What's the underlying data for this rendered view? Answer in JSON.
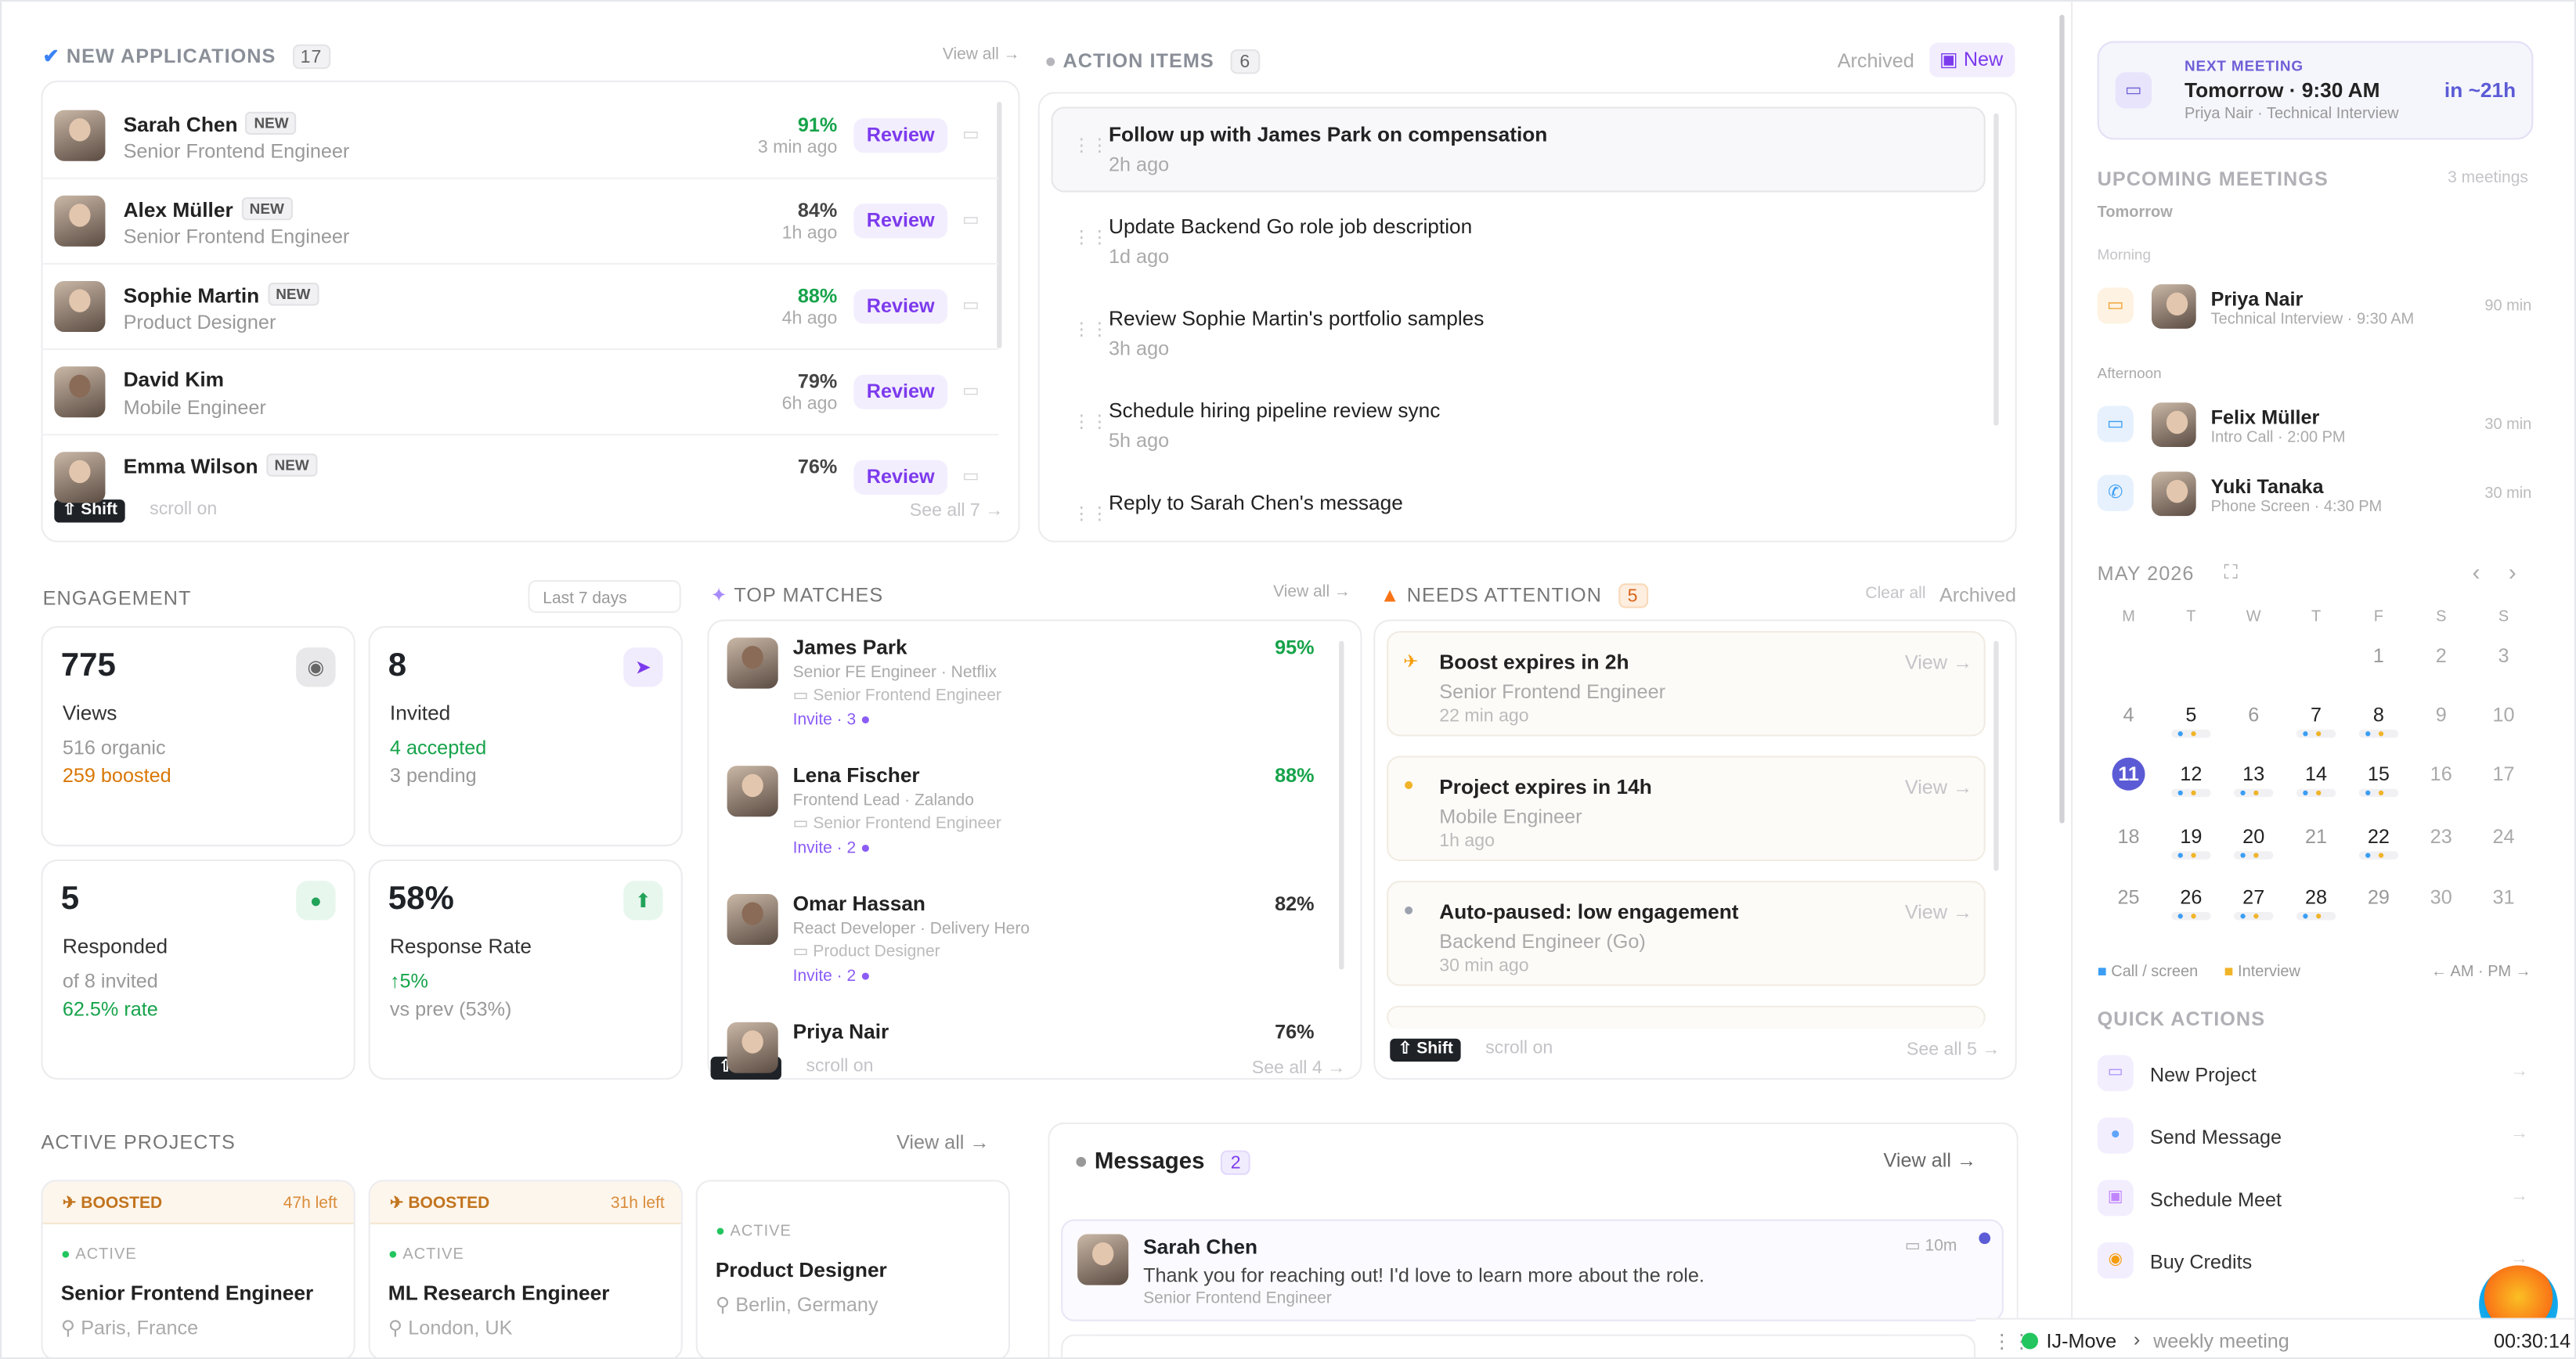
{
  "applications": {
    "title": "NEW APPLICATIONS",
    "count": "17",
    "view_all": "View all →",
    "items": [
      {
        "name": "Sarah Chen",
        "badge": "NEW",
        "role": "Senior Frontend Engineer",
        "score": "91%",
        "time": "3 min ago",
        "action": "Review"
      },
      {
        "name": "Alex Müller",
        "badge": "NEW",
        "role": "Senior Frontend Engineer",
        "score": "84%",
        "time": "1h ago",
        "action": "Review"
      },
      {
        "name": "Sophie Martin",
        "badge": "NEW",
        "role": "Product Designer",
        "score": "88%",
        "time": "4h ago",
        "action": "Review"
      },
      {
        "name": "David Kim",
        "badge": "",
        "role": "Mobile Engineer",
        "score": "79%",
        "time": "6h ago",
        "action": "Review"
      },
      {
        "name": "Emma Wilson",
        "badge": "NEW",
        "role": "",
        "score": "76%",
        "time": "",
        "action": "Review"
      }
    ],
    "shift": "⇧ Shift",
    "scroll_hint": "scroll on",
    "see_all": "See all 7 →"
  },
  "actions": {
    "title": "ACTION ITEMS",
    "count": "6",
    "archived": "Archived",
    "new_label": "New",
    "items": [
      {
        "text": "Follow up with James Park on compensation",
        "time": "2h ago"
      },
      {
        "text": "Update Backend Go role job description",
        "time": "1d ago"
      },
      {
        "text": "Review Sophie Martin's portfolio samples",
        "time": "3h ago"
      },
      {
        "text": "Schedule hiring pipeline review sync",
        "time": "5h ago"
      },
      {
        "text": "Reply to Sarah Chen's message",
        "time": ""
      }
    ]
  },
  "engagement": {
    "title": "ENGAGEMENT",
    "range": "Last 7 days",
    "views": {
      "num": "775",
      "label": "Views",
      "l1": "516 organic",
      "l2": "259 boosted"
    },
    "invited": {
      "num": "8",
      "label": "Invited",
      "l1": "4 accepted",
      "l2": "3 pending"
    },
    "responded": {
      "num": "5",
      "label": "Responded",
      "l1": "of 8 invited",
      "l2": "62.5% rate"
    },
    "rate": {
      "num": "58%",
      "label": "Response Rate",
      "l1": "↑5%",
      "l2": "vs prev (53%)"
    }
  },
  "matches": {
    "title": "TOP MATCHES",
    "view_all": "View all →",
    "items": [
      {
        "name": "James Park",
        "sub": "Senior FE Engineer · Netflix",
        "role": "Senior Frontend Engineer",
        "invite": "Invite · 3",
        "score": "95%"
      },
      {
        "name": "Lena Fischer",
        "sub": "Frontend Lead · Zalando",
        "role": "Senior Frontend Engineer",
        "invite": "Invite · 2",
        "score": "88%"
      },
      {
        "name": "Omar Hassan",
        "sub": "React Developer · Delivery Hero",
        "role": "Product Designer",
        "invite": "Invite · 2",
        "score": "82%"
      },
      {
        "name": "Priya Nair",
        "sub": "",
        "role": "",
        "invite": "",
        "score": "76%"
      }
    ],
    "shift": "⇧ Shift",
    "scroll_hint": "scroll on",
    "see_all": "See all 4 →"
  },
  "attention": {
    "title": "NEEDS ATTENTION",
    "count": "5",
    "clear_all": "Clear all",
    "archived": "Archived",
    "items": [
      {
        "title": "Boost expires in 2h",
        "sub": "Senior Frontend Engineer",
        "time": "22 min ago",
        "view": "View →"
      },
      {
        "title": "Project expires in 14h",
        "sub": "Mobile Engineer",
        "time": "1h ago",
        "view": "View →"
      },
      {
        "title": "Auto-paused: low engagement",
        "sub": "Backend Engineer (Go)",
        "time": "30 min ago",
        "view": "View →"
      }
    ],
    "shift": "⇧ Shift",
    "scroll_hint": "scroll on",
    "see_all": "See all 5 →"
  },
  "projects": {
    "title": "ACTIVE PROJECTS",
    "view_all": "View all →",
    "items": [
      {
        "boost": "BOOSTED",
        "left": "47h left",
        "status": "ACTIVE",
        "name": "Senior Frontend Engineer",
        "location": "Paris, France"
      },
      {
        "boost": "BOOSTED",
        "left": "31h left",
        "status": "ACTIVE",
        "name": "ML Research Engineer",
        "location": "London, UK"
      },
      {
        "boost": "",
        "left": "",
        "status": "ACTIVE",
        "name": "Product Designer",
        "location": "Berlin, Germany"
      }
    ]
  },
  "messages": {
    "title": "Messages",
    "count": "2",
    "view_all": "View all →",
    "items": [
      {
        "name": "Sarah Chen",
        "text": "Thank you for reaching out! I'd love to learn more about the role.",
        "role": "Senior Frontend Engineer",
        "time": "10m"
      }
    ]
  },
  "next_meeting": {
    "label": "NEXT MEETING",
    "when": "Tomorrow · 9:30 AM",
    "who": "Priya Nair · Technical Interview",
    "in": "in ~21h"
  },
  "upcoming": {
    "title": "UPCOMING MEETINGS",
    "count": "3 meetings",
    "day": "Tomorrow",
    "morning": "Morning",
    "afternoon": "Afternoon",
    "items": [
      {
        "name": "Priya Nair",
        "sub": "Technical Interview · 9:30 AM",
        "dur": "90 min"
      },
      {
        "name": "Felix Müller",
        "sub": "Intro Call · 2:00 PM",
        "dur": "30 min"
      },
      {
        "name": "Yuki Tanaka",
        "sub": "Phone Screen · 4:30 PM",
        "dur": "30 min"
      }
    ]
  },
  "calendar": {
    "month": "MAY 2026",
    "weekdays": [
      "M",
      "T",
      "W",
      "T",
      "F",
      "S",
      "S"
    ],
    "rows": [
      [
        "",
        "",
        "",
        "",
        "1",
        "2",
        "3"
      ],
      [
        "4",
        "5",
        "6",
        "7",
        "8",
        "9",
        "10"
      ],
      [
        "11",
        "12",
        "13",
        "14",
        "15",
        "16",
        "17"
      ],
      [
        "18",
        "19",
        "20",
        "21",
        "22",
        "23",
        "24"
      ],
      [
        "25",
        "26",
        "27",
        "28",
        "29",
        "30",
        "31"
      ]
    ],
    "today": "11",
    "legend_call": "Call / screen",
    "legend_interview": "Interview",
    "legend_ampm": "← AM · PM →"
  },
  "quick_actions": {
    "title": "QUICK ACTIONS",
    "items": [
      "New Project",
      "Send Message",
      "Schedule Meet",
      "Buy Credits"
    ]
  },
  "status_bar": {
    "app": "IJ-Move",
    "task": "weekly meeting",
    "timer": "00:30:14"
  },
  "colors": {
    "accent": "#7c3aed",
    "green": "#16a34a",
    "orange": "#d97706",
    "blue": "#3b82f6"
  }
}
